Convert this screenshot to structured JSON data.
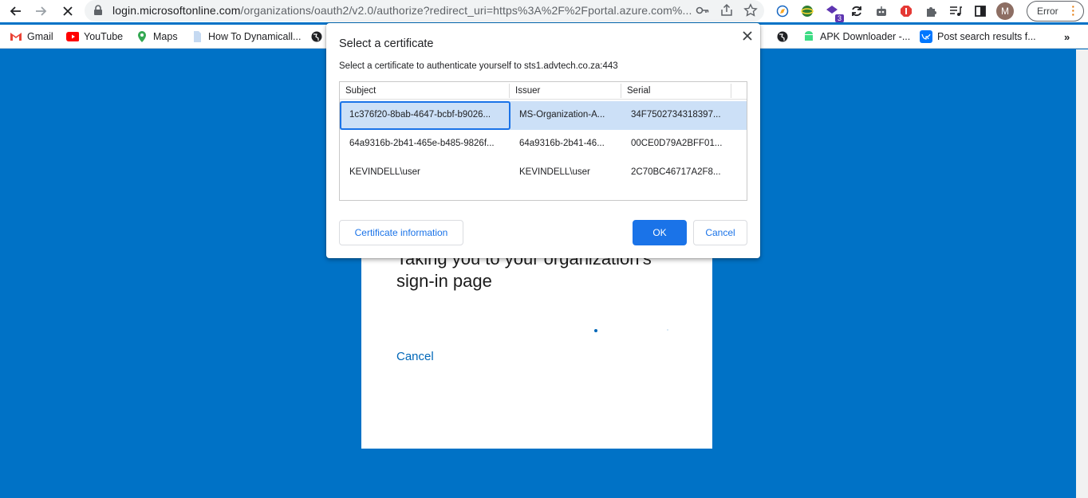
{
  "browser": {
    "url_host": "login.microsoftonline.com",
    "url_path": "/organizations/oauth2/v2.0/authorize?redirect_uri=https%3A%2F%2Fportal.azure.com%...",
    "extension_badge": "3",
    "avatar_initial": "M",
    "status_label": "Error"
  },
  "bookmarks": {
    "items": [
      {
        "label": "Gmail",
        "icon": "gmail-icon"
      },
      {
        "label": "YouTube",
        "icon": "youtube-icon"
      },
      {
        "label": "Maps",
        "icon": "maps-icon"
      },
      {
        "label": "How To Dynamicall...",
        "icon": "page-icon"
      },
      {
        "label": "APK Downloader -...",
        "icon": "android-icon"
      },
      {
        "label": "Post search results f...",
        "icon": "vk-icon"
      }
    ]
  },
  "page": {
    "heading": "Taking you to your organization's sign-in page",
    "cancel_link": "Cancel"
  },
  "dialog": {
    "title": "Select a certificate",
    "subtitle": "Select a certificate to authenticate yourself to sts1.advtech.co.za:443",
    "columns": [
      "Subject",
      "Issuer",
      "Serial"
    ],
    "rows": [
      {
        "subject": "1c376f20-8bab-4647-bcbf-b9026...",
        "issuer": "MS-Organization-A...",
        "serial": "34F7502734318397...",
        "selected": true
      },
      {
        "subject": "64a9316b-2b41-465e-b485-9826f...",
        "issuer": "64a9316b-2b41-46...",
        "serial": "00CE0D79A2BFF01...",
        "selected": false
      },
      {
        "subject": "KEVINDELL\\user",
        "issuer": "KEVINDELL\\user",
        "serial": "2C70BC46717A2F8...",
        "selected": false
      }
    ],
    "info_button": "Certificate information",
    "ok_button": "OK",
    "cancel_button": "Cancel"
  },
  "colors": {
    "page_background": "#0072c6",
    "accent": "#1a73e8",
    "selected_row": "#cce0f7",
    "link": "#0067b8"
  }
}
